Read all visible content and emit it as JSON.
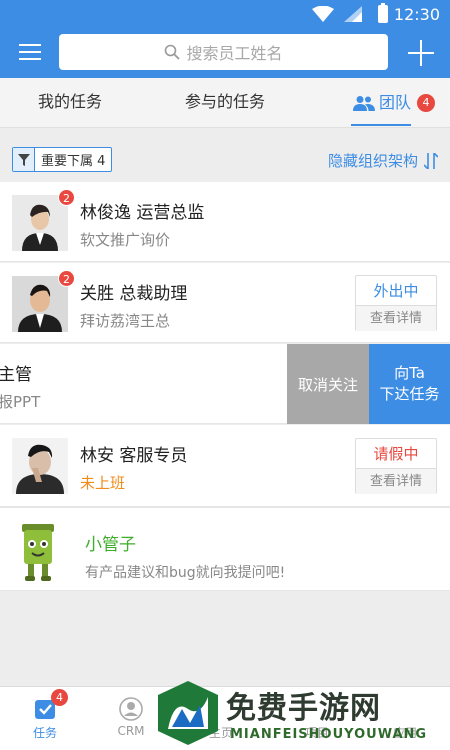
{
  "status_bar": {
    "time": "12:30"
  },
  "search": {
    "placeholder": "搜索员工姓名"
  },
  "tabs": [
    {
      "label": "我的任务"
    },
    {
      "label": "参与的任务"
    },
    {
      "label": "团队",
      "badge": "4",
      "active": true
    }
  ],
  "filter": {
    "chip_label": "重要下属 4",
    "hide_org_label": "隐藏组织架构"
  },
  "members": [
    {
      "name": "林俊逸 运营总监",
      "sub": "软文推广询价",
      "badge": "2"
    },
    {
      "name": "关胜 总裁助理",
      "sub": "拜访荔湾王总",
      "badge": "2",
      "status": "外出中",
      "detail": "查看详情",
      "status_color": "#3d8de4"
    },
    {
      "name": "主管",
      "sub": "报PPT",
      "actions": {
        "cancel": "取消关注",
        "assign_line1": "向Ta",
        "assign_line2": "下达任务"
      }
    },
    {
      "name": "林安 客服专员",
      "sub": "未上班",
      "status": "请假中",
      "detail": "查看详情",
      "status_color": "#e8483f"
    }
  ],
  "bot": {
    "name": "小管子",
    "sub": "有产品建议和bug就向我提问吧!"
  },
  "bottom_nav": [
    {
      "label": "任务",
      "badge": "4",
      "active": true
    },
    {
      "label": "CRM"
    },
    {
      "label": "主页"
    },
    {
      "label": "项目"
    },
    {
      "label": "应用"
    }
  ],
  "watermark": {
    "title": "免费手游网",
    "sub": "MIANFEISHOUYOUWANG"
  },
  "colors": {
    "primary": "#3d8de4",
    "badge": "#e8483f",
    "green": "#3fae2a",
    "orange": "#f08c1c"
  }
}
